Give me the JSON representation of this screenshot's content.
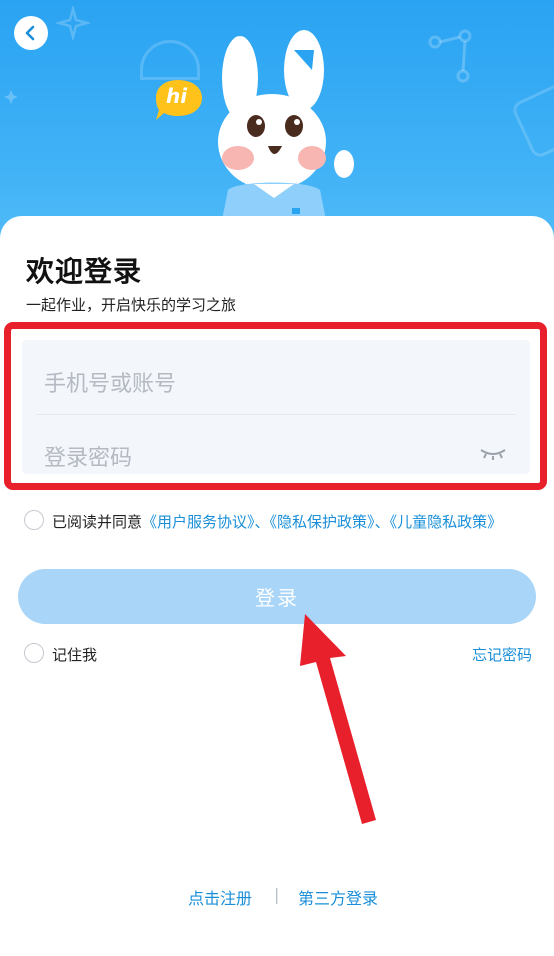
{
  "header": {
    "back_icon": "chevron-left-icon",
    "mascot_bubble": "hi",
    "mascot": "bunny-mascot"
  },
  "login": {
    "title": "欢迎登录",
    "subtitle": "一起作业，开启快乐的学习之旅",
    "account_placeholder": "手机号或账号",
    "password_placeholder": "登录密码",
    "password_visibility_icon": "eye-closed-icon",
    "agreement_prefix": "已阅读并同意",
    "agreement_user_terms": "《用户服务协议》",
    "agreement_sep": "、",
    "agreement_privacy": "《隐私保护政策》",
    "agreement_child_privacy": "《儿童隐私政策》",
    "login_button": "登录",
    "remember_me": "记住我",
    "forgot_password": "忘记密码"
  },
  "footer": {
    "register": "点击注册",
    "separator": "|",
    "third_party_login": "第三方登录"
  },
  "colors": {
    "accent": "#1a8fd8",
    "header_bg": "#2aa3f2",
    "button_disabled": "#a8d5f8",
    "highlight": "#e8202b"
  }
}
